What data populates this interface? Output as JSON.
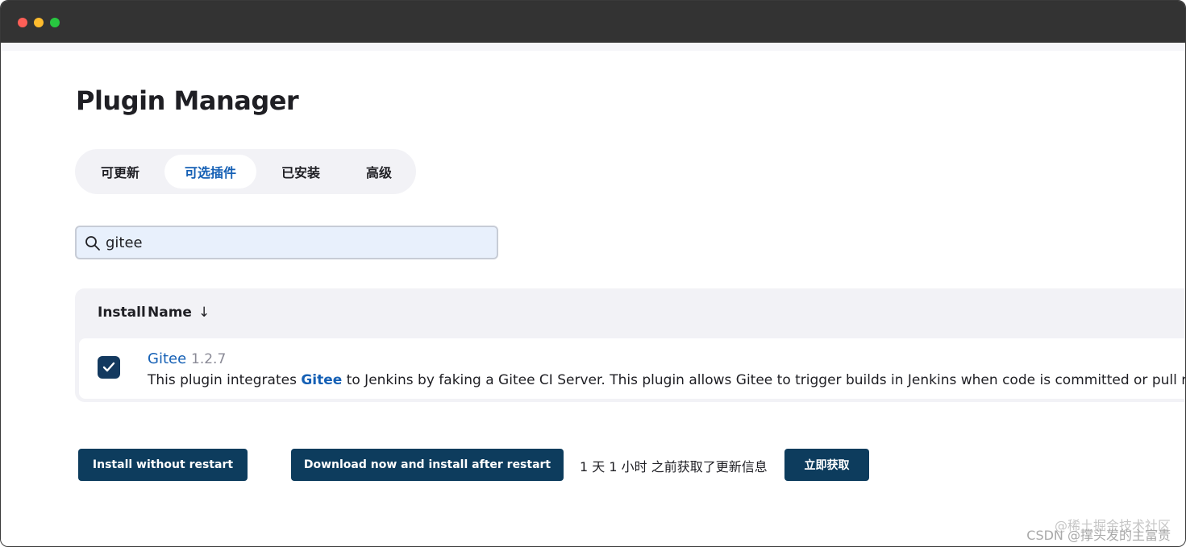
{
  "page": {
    "title": "Plugin Manager"
  },
  "tabs": [
    {
      "label": "可更新",
      "active": false
    },
    {
      "label": "可选插件",
      "active": true
    },
    {
      "label": "已安装",
      "active": false
    },
    {
      "label": "高级",
      "active": false
    }
  ],
  "search": {
    "value": "gitee",
    "icon": "search-icon"
  },
  "table": {
    "columns": {
      "install": "Install",
      "name": "Name",
      "sort_arrow": "↓"
    },
    "rows": [
      {
        "checked": true,
        "name": "Gitee",
        "version": "1.2.7",
        "description_prefix": "This plugin integrates ",
        "description_highlight": "Gitee",
        "description_suffix": " to Jenkins by faking a Gitee CI Server. This plugin allows Gitee to trigger builds in Jenkins when code is committed or pull requests are"
      }
    ]
  },
  "actions": {
    "install_without_restart": "Install without restart",
    "download_install_after_restart": "Download now and install after restart",
    "status_text": "1 天 1 小时 之前获取了更新信息",
    "fetch_now": "立即获取"
  },
  "watermark": {
    "line1": "@稀土掘金技术社区",
    "line2": "CSDN @撑头发的主富贵"
  },
  "colors": {
    "accent": "#1560b5",
    "button": "#0d3c5d",
    "titlebar": "#333333"
  }
}
